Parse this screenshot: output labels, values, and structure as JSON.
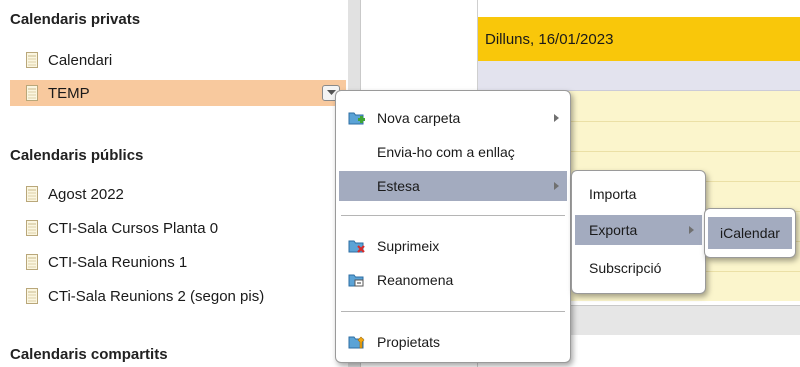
{
  "sidebar": {
    "private_title": "Calendaris privats",
    "private_items": [
      {
        "label": "Calendari",
        "selected": false
      },
      {
        "label": "TEMP",
        "selected": true
      }
    ],
    "public_title": "Calendaris públics",
    "public_items": [
      {
        "label": "Agost 2022"
      },
      {
        "label": "CTI-Sala Cursos Planta 0"
      },
      {
        "label": "CTI-Sala Reunions 1"
      },
      {
        "label": "CTi-Sala Reunions 2 (segon pis)"
      }
    ],
    "shared_title": "Calendaris compartits"
  },
  "calendar": {
    "day_header": "Dilluns, 16/01/2023",
    "header_color": "#f9c70a"
  },
  "context_menu": {
    "items": [
      {
        "label": "Nova carpeta",
        "icon": "new-folder-icon",
        "has_submenu": true
      },
      {
        "label": "Envia-ho com a enllaç",
        "icon": "",
        "has_submenu": false
      },
      {
        "label": "Estesa",
        "icon": "",
        "has_submenu": true,
        "active": true
      },
      {
        "label": "Suprimeix",
        "icon": "delete-folder-icon",
        "has_submenu": false
      },
      {
        "label": "Reanomena",
        "icon": "rename-icon",
        "has_submenu": false
      },
      {
        "label": "Propietats",
        "icon": "properties-icon",
        "has_submenu": false
      }
    ]
  },
  "submenu": {
    "items": [
      {
        "label": "Importa",
        "has_submenu": false
      },
      {
        "label": "Exporta",
        "has_submenu": true,
        "active": true
      },
      {
        "label": "Subscripció",
        "has_submenu": false
      }
    ]
  },
  "submenu2": {
    "items": [
      {
        "label": "iCalendar"
      }
    ]
  },
  "colors": {
    "selected_row": "#f8c99e",
    "menu_highlight": "#a3abbf",
    "allday_row": "#e3e3ee",
    "hour_slots": "#fbf5cc"
  }
}
